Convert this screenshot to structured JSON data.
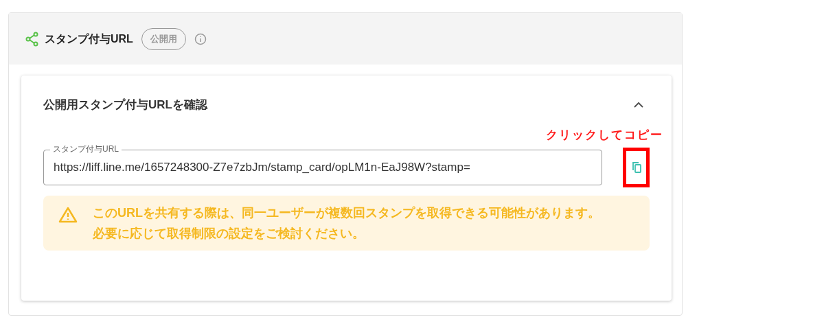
{
  "panel": {
    "title": "スタンプ付与URL",
    "badge": "公開用"
  },
  "card": {
    "title": "公開用スタンプ付与URLを確認",
    "expanded": true,
    "field": {
      "label": "スタンプ付与URL",
      "value": "https://liff.line.me/1657248300-Z7e7zbJm/stamp_card/opLM1n-EaJ98W?stamp="
    },
    "annotation": "クリックしてコピー",
    "warning": [
      "このURLを共有する際は、同一ユーザーが複数回スタンプを取得できる可能性があります。",
      "必要に応じて取得制限の設定をご検討ください。"
    ]
  }
}
